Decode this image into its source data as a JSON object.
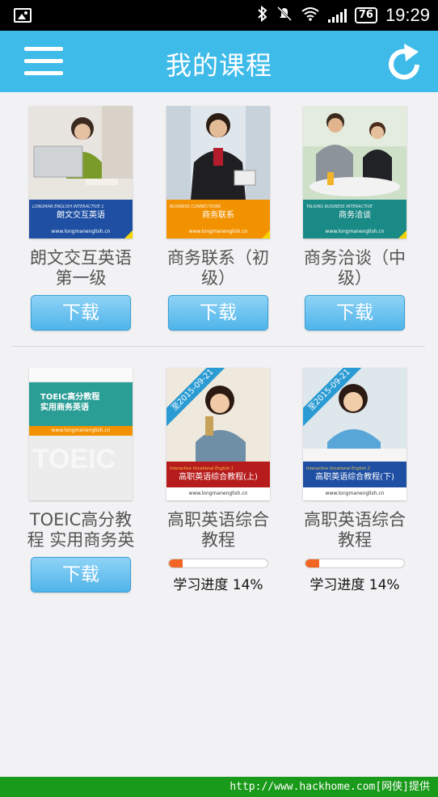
{
  "status_bar": {
    "battery": "76",
    "time": "19:29",
    "icons": [
      "gallery-icon",
      "bluetooth-icon",
      "mute-icon",
      "wifi-icon",
      "signal-icon",
      "battery-icon"
    ]
  },
  "header": {
    "title": "我的课程",
    "menu_icon": "hamburger-menu-icon",
    "refresh_icon": "refresh-icon"
  },
  "courses": [
    {
      "title": "朗文交互英语第一级",
      "cover_series": "LONGMAN ENGLISH INTERACTIVE 1",
      "cover_title": "朗文交互英语",
      "cover_url": "www.longmanenglish.cn",
      "band_color": "#1e4fa3",
      "action": "下载"
    },
    {
      "title": "商务联系（初级）",
      "cover_series": "BUSINESS CONNECTIONS",
      "cover_title": "商务联系",
      "cover_url": "www.longmanenglish.cn",
      "band_color": "#f39200",
      "action": "下载"
    },
    {
      "title": "商务洽谈（中级）",
      "cover_series": "TALKING BUSINESS INTERACTIVE",
      "cover_title": "商务洽谈",
      "cover_url": "www.longmanenglish.cn",
      "band_color": "#1a8a86",
      "action": "下载"
    },
    {
      "title": "TOEIC高分教程 实用商务英",
      "cover_title_line1": "TOEIC高分教程",
      "cover_title_line2": "实用商务英语",
      "cover_url": "www.longmanenglish.cn",
      "cover_watermark": "TOEIC",
      "action": "下载"
    },
    {
      "title": "高职英语综合教程",
      "cover_series": "Interactive Vocational English 1",
      "cover_title": "高职英语综合教程(上)",
      "cover_url": "www.longmanenglish.cn",
      "ribbon": "至2015-09-21",
      "band_color": "#b71c1c",
      "progress_label": "学习进度 14%",
      "progress": 0.14
    },
    {
      "title": "高职英语综合教程",
      "cover_series": "Interactive Vocational English 2",
      "cover_title": "高职英语综合教程(下)",
      "cover_url": "www.longmanenglish.cn",
      "ribbon": "至2015-09-21",
      "band_color": "#1e4fa3",
      "progress_label": "学习进度 14%",
      "progress": 0.14
    }
  ],
  "footer": {
    "text": "http://www.hackhome.com[网侠]提供"
  },
  "colors": {
    "header": "#3fbbe9",
    "button": "#5bbcee",
    "progress": "#f26522",
    "footer": "#1a9a1a"
  }
}
